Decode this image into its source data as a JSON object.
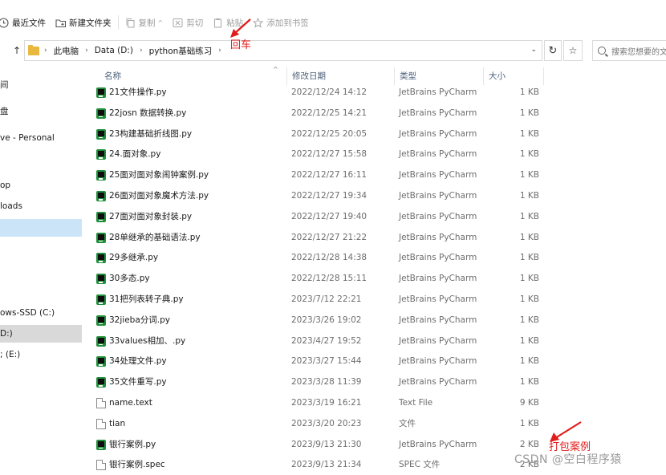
{
  "toolbar": {
    "items": [
      {
        "label": "最近文件",
        "disabled": false
      },
      {
        "label": "新建文件夹",
        "disabled": false
      },
      {
        "label": "复制",
        "disabled": true
      },
      {
        "label": "剪切",
        "disabled": true
      },
      {
        "label": "粘贴",
        "disabled": true
      },
      {
        "label": "添加到书签",
        "disabled": true
      }
    ]
  },
  "address": {
    "crumbs": [
      "此电脑",
      "Data (D:)",
      "python基础练习"
    ],
    "search_placeholder": "搜索您想要的文"
  },
  "sidebar": {
    "items": [
      {
        "label": "间",
        "state": ""
      },
      {
        "label": "盘",
        "state": ""
      },
      {
        "label": "ve - Personal",
        "state": ""
      },
      {
        "label": "op",
        "state": ""
      },
      {
        "label": "loads",
        "state": ""
      },
      {
        "label": "",
        "state": "sel"
      },
      {
        "label": "ows-SSD (C:)",
        "state": ""
      },
      {
        "label": "D:)",
        "state": "sel-gray"
      },
      {
        "label": "; (E:)",
        "state": ""
      }
    ]
  },
  "columns": {
    "name": "名称",
    "date": "修改日期",
    "type": "类型",
    "size": "大小"
  },
  "files": [
    {
      "name": "21文件操作.py",
      "date": "2022/12/24 14:12",
      "type": "JetBrains PyCharm",
      "size": "1 KB",
      "icon": "py"
    },
    {
      "name": "22josn 数据转换.py",
      "date": "2022/12/25 14:21",
      "type": "JetBrains PyCharm",
      "size": "1 KB",
      "icon": "py"
    },
    {
      "name": "23构建基础折线图.py",
      "date": "2022/12/25 20:05",
      "type": "JetBrains PyCharm",
      "size": "1 KB",
      "icon": "py"
    },
    {
      "name": "24.面对象.py",
      "date": "2022/12/27 15:58",
      "type": "JetBrains PyCharm",
      "size": "1 KB",
      "icon": "py"
    },
    {
      "name": "25面对面对象闹钟案例.py",
      "date": "2022/12/27 16:11",
      "type": "JetBrains PyCharm",
      "size": "1 KB",
      "icon": "py"
    },
    {
      "name": "26面对面对象魔术方法.py",
      "date": "2022/12/27 19:34",
      "type": "JetBrains PyCharm",
      "size": "1 KB",
      "icon": "py"
    },
    {
      "name": "27面对面对象封装.py",
      "date": "2022/12/27 19:40",
      "type": "JetBrains PyCharm",
      "size": "1 KB",
      "icon": "py"
    },
    {
      "name": "28单继承的基础语法.py",
      "date": "2022/12/27 21:22",
      "type": "JetBrains PyCharm",
      "size": "1 KB",
      "icon": "py"
    },
    {
      "name": "29多继承.py",
      "date": "2022/12/28 14:38",
      "type": "JetBrains PyCharm",
      "size": "1 KB",
      "icon": "py"
    },
    {
      "name": "30多态.py",
      "date": "2022/12/28 15:11",
      "type": "JetBrains PyCharm",
      "size": "1 KB",
      "icon": "py"
    },
    {
      "name": "31把列表转子典.py",
      "date": "2023/7/12 22:21",
      "type": "JetBrains PyCharm",
      "size": "1 KB",
      "icon": "py"
    },
    {
      "name": "32jieba分词.py",
      "date": "2023/3/26 19:02",
      "type": "JetBrains PyCharm",
      "size": "1 KB",
      "icon": "py"
    },
    {
      "name": "33values相加、.py",
      "date": "2023/4/27 19:52",
      "type": "JetBrains PyCharm",
      "size": "1 KB",
      "icon": "py"
    },
    {
      "name": "34处理文件.py",
      "date": "2023/3/27 15:44",
      "type": "JetBrains PyCharm",
      "size": "1 KB",
      "icon": "py"
    },
    {
      "name": "35文件重写.py",
      "date": "2023/3/28 11:39",
      "type": "JetBrains PyCharm",
      "size": "1 KB",
      "icon": "py"
    },
    {
      "name": "name.text",
      "date": "2023/3/19 16:21",
      "type": "Text File",
      "size": "9 KB",
      "icon": "doc"
    },
    {
      "name": "tian",
      "date": "2023/3/20 20:23",
      "type": "文件",
      "size": "1 KB",
      "icon": "doc"
    },
    {
      "name": "银行案例.py",
      "date": "2023/9/13 21:30",
      "type": "JetBrains PyCharm",
      "size": "2 KB",
      "icon": "py"
    },
    {
      "name": "银行案例.spec",
      "date": "2023/9/13 21:34",
      "type": "SPEC 文件",
      "size": "2 KB",
      "icon": "doc"
    }
  ],
  "annotations": {
    "enter": "回车",
    "pack": "打包案例",
    "color": "#e21b1b"
  },
  "watermark": "CSDN @空白程序猿"
}
